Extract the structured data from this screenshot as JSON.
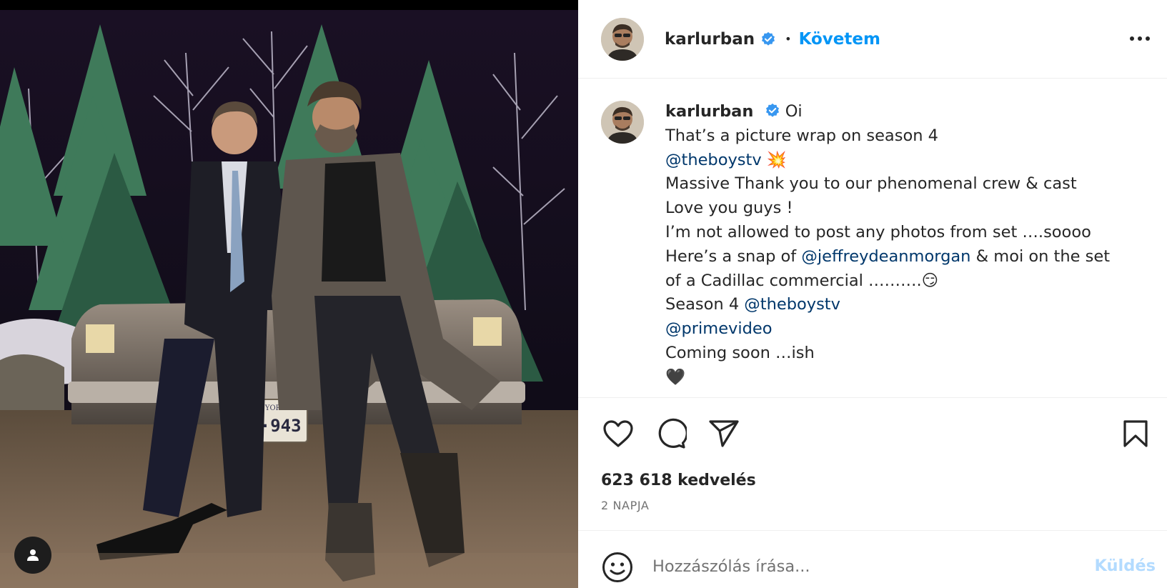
{
  "post": {
    "username": "karlurban",
    "verified": true,
    "follow_status": "Követem",
    "separator": "•",
    "more_icon": "more-horizontal-icon"
  },
  "caption": {
    "username": "karlurban",
    "lines": [
      {
        "parts": [
          {
            "text": "Oi"
          }
        ]
      },
      {
        "parts": [
          {
            "text": "That’s a picture wrap on season 4"
          }
        ]
      },
      {
        "parts": [
          {
            "text": "@theboystv",
            "mention": true
          },
          {
            "text": " 💥"
          }
        ]
      },
      {
        "parts": [
          {
            "text": "Massive Thank you to our phenomenal crew & cast"
          }
        ]
      },
      {
        "parts": [
          {
            "text": "Love you guys !"
          }
        ]
      },
      {
        "parts": [
          {
            "text": "I’m not allowed to post any photos from set ….soooo"
          }
        ]
      },
      {
        "parts": [
          {
            "text": "Here’s a snap of "
          },
          {
            "text": "@jeffreydeanmorgan",
            "mention": true
          },
          {
            "text": " & moi on the set"
          }
        ]
      },
      {
        "parts": [
          {
            "text": "of a Cadillac commercial ……….😏"
          }
        ]
      },
      {
        "parts": [
          {
            "text": "Season 4 "
          },
          {
            "text": "@theboystv",
            "mention": true
          }
        ]
      },
      {
        "parts": [
          {
            "text": "@primevideo",
            "mention": true
          }
        ]
      },
      {
        "parts": [
          {
            "text": "Coming soon …ish"
          }
        ]
      },
      {
        "parts": [
          {
            "text": "🖤"
          }
        ]
      }
    ]
  },
  "actions": {
    "like_icon": "heart-icon",
    "comment_icon": "comment-icon",
    "share_icon": "paper-plane-icon",
    "save_icon": "bookmark-icon"
  },
  "likes_text": "623 618 kedvelés",
  "timestamp": "2 NAPJA",
  "comment": {
    "placeholder": "Hozzászólás írása...",
    "send_label": "Küldés",
    "emoji_icon": "smiley-icon"
  },
  "photo": {
    "plate_state": "NEW YORK",
    "plate_number": "MQW·943",
    "tag_icon": "user-tag-icon"
  },
  "colors": {
    "accent": "#0095f6",
    "verified_badge": "#3897f0",
    "mention": "#00376b",
    "muted": "#737373",
    "send_disabled": "#b3dbff"
  }
}
